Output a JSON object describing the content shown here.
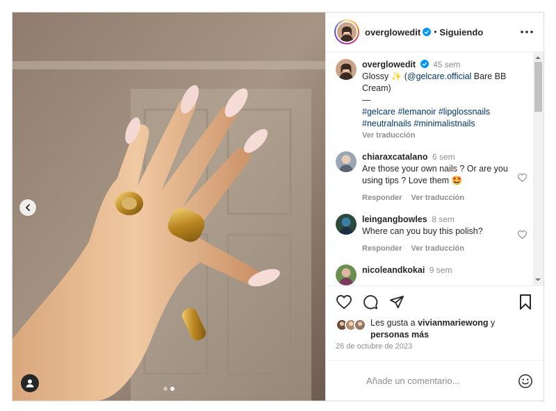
{
  "post": {
    "username": "overglowedit",
    "follow_status": "Siguiendo",
    "separator": "•",
    "caption": {
      "age": "45 sem",
      "line1_text": "Glossy ",
      "line1_emoji": "✨",
      "line1_open": " (",
      "mention": "@gelcare.official",
      "line1_rest": " Bare BB Cream)",
      "dash": "—",
      "hashtags": [
        "#gelcare",
        "#lemanoir",
        "#lipglossnails",
        "#neutralnails",
        "#minimalistnails"
      ],
      "translate": "Ver traducción"
    },
    "comments": [
      {
        "user": "chiaraxcatalano",
        "age": "6 sem",
        "text": "Are those your own nails ? Or are you using tips ? Love them 🤩",
        "reply": "Responder",
        "translate": "Ver traducción"
      },
      {
        "user": "leingangbowles",
        "age": "8 sem",
        "text": "Where can you buy this polish?",
        "reply": "Responder",
        "translate": "Ver traducción"
      },
      {
        "user": "nicoleandkokai",
        "age": "9 sem",
        "text": "",
        "reply": "",
        "translate": ""
      }
    ],
    "likes": {
      "prefix": "Les gusta a ",
      "user": "vivianmariewong",
      "middle": " y",
      "others": "personas más"
    },
    "date": "26 de octubre de 2023",
    "add_comment_placeholder": "Añade un comentario...",
    "carousel": {
      "count": 2,
      "active_index": 1
    }
  },
  "colors": {
    "link": "#00376b",
    "verified": "#0095f6",
    "secondary_text": "#8e8e8e",
    "border": "#efefef"
  },
  "icons": [
    "chevron-left-icon",
    "user-tag-icon",
    "verified-icon",
    "more-icon",
    "heart-icon",
    "comment-icon",
    "share-icon",
    "bookmark-icon",
    "emoji-icon"
  ]
}
